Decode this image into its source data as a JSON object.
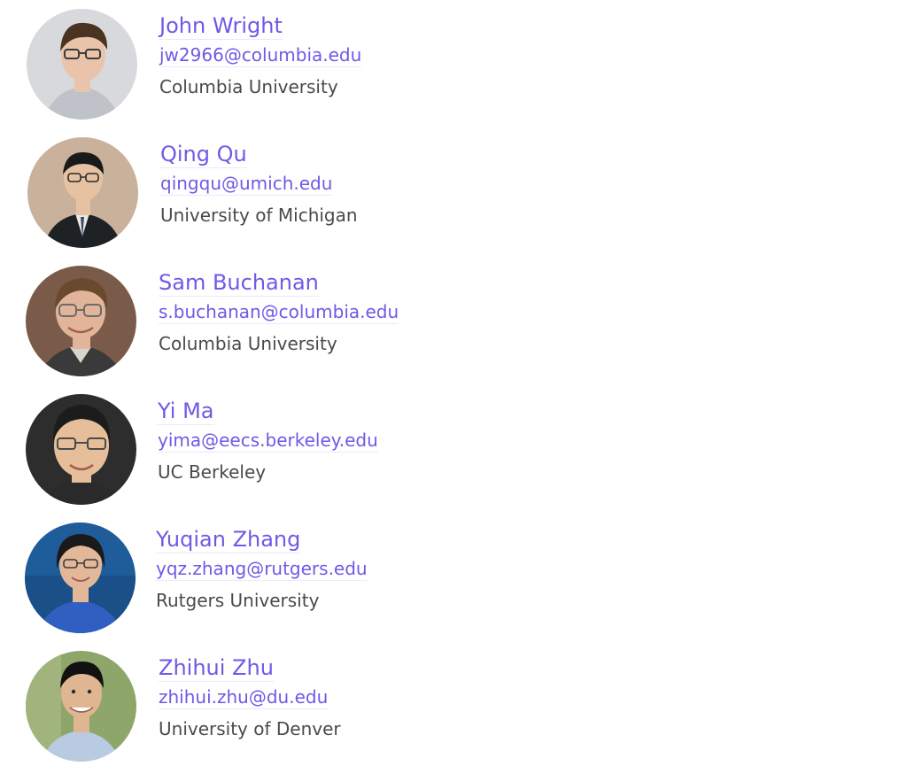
{
  "people": [
    {
      "name": "John Wright",
      "email": "jw2966@columbia.edu",
      "affiliation": "Columbia University",
      "avatar": {
        "bg": "#d8d9dc",
        "hair": "#4a3320",
        "skin": "#e9c4aa",
        "shirt": "#bfc2c8",
        "glasses": true
      }
    },
    {
      "name": "Qing Qu",
      "email": "qingqu@umich.edu",
      "affiliation": "University of Michigan",
      "avatar": {
        "bg": "#c9b19b",
        "hair": "#1a1a1a",
        "skin": "#e6c2a2",
        "shirt": "#1f2225",
        "glasses": true
      }
    },
    {
      "name": "Sam Buchanan",
      "email": "s.buchanan@columbia.edu",
      "affiliation": "Columbia University",
      "avatar": {
        "bg": "#7a5b4a",
        "hair": "#6a4a2e",
        "skin": "#e2b59b",
        "shirt": "#3a3a3a",
        "glasses": true
      }
    },
    {
      "name": "Yi Ma",
      "email": "yima@eecs.berkeley.edu",
      "affiliation": "UC Berkeley",
      "avatar": {
        "bg": "#2d2d2d",
        "hair": "#1c1c1c",
        "skin": "#e6bf9a",
        "shirt": "#2a2a2a",
        "glasses": true
      }
    },
    {
      "name": "Yuqian Zhang",
      "email": "yqz.zhang@rutgers.edu",
      "affiliation": "Rutgers University",
      "avatar": {
        "bg": "#1f5d9a",
        "hair": "#1a1a1a",
        "skin": "#e3b899",
        "shirt": "#2f5fc0",
        "glasses": true
      }
    },
    {
      "name": "Zhihui Zhu",
      "email": "zhihui.zhu@du.edu",
      "affiliation": "University of Denver",
      "avatar": {
        "bg": "#8ea66a",
        "hair": "#111111",
        "skin": "#e0b592",
        "shirt": "#b8cbe3",
        "glasses": false
      }
    }
  ]
}
